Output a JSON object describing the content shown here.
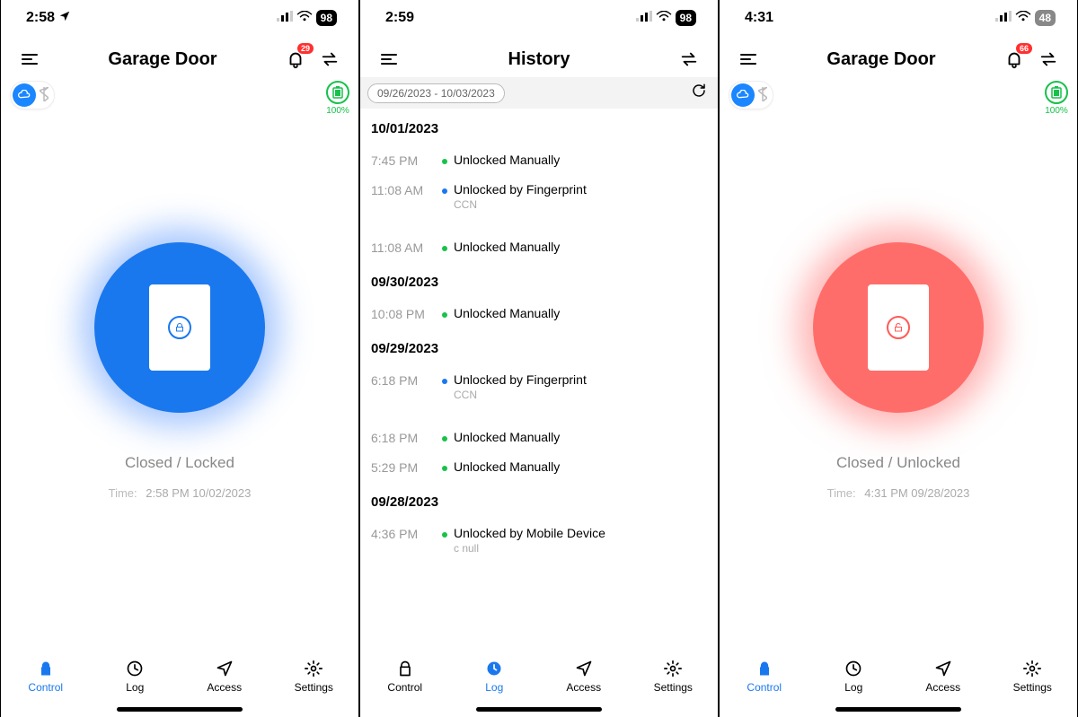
{
  "screens": {
    "control_locked": {
      "statusbar": {
        "time": "2:58",
        "location_arrow": true,
        "battery": "98"
      },
      "header": {
        "title": "Garage Door",
        "bell_badge": "29"
      },
      "battery_pct": "100%",
      "status_text": "Closed / Locked",
      "time_label": "Time:",
      "time_value": "2:58 PM 10/02/2023",
      "circle_color": "blue",
      "lock_state": "locked",
      "tabs": {
        "control": "Control",
        "log": "Log",
        "access": "Access",
        "settings": "Settings"
      },
      "active_tab": "control"
    },
    "history": {
      "statusbar": {
        "time": "2:59",
        "location_arrow": false,
        "battery": "98"
      },
      "header": {
        "title": "History"
      },
      "filter_range": "09/26/2023 - 10/03/2023",
      "days": [
        {
          "date": "10/01/2023",
          "entries": [
            {
              "time": "7:45 PM",
              "dot": "green",
              "text": "Unlocked Manually"
            },
            {
              "time": "11:08 AM",
              "dot": "blue",
              "text": "Unlocked by Fingerprint",
              "sub": "CCN"
            },
            {
              "time": "11:08 AM",
              "dot": "green",
              "text": "Unlocked Manually"
            }
          ]
        },
        {
          "date": "09/30/2023",
          "entries": [
            {
              "time": "10:08 PM",
              "dot": "green",
              "text": "Unlocked Manually"
            }
          ]
        },
        {
          "date": "09/29/2023",
          "entries": [
            {
              "time": "6:18 PM",
              "dot": "blue",
              "text": "Unlocked by Fingerprint",
              "sub": "CCN"
            },
            {
              "time": "6:18 PM",
              "dot": "green",
              "text": "Unlocked Manually"
            },
            {
              "time": "5:29 PM",
              "dot": "green",
              "text": "Unlocked Manually"
            }
          ]
        },
        {
          "date": "09/28/2023",
          "entries": [
            {
              "time": "4:36 PM",
              "dot": "green",
              "text": "Unlocked by Mobile Device",
              "sub": "c null"
            }
          ]
        }
      ],
      "tabs": {
        "control": "Control",
        "log": "Log",
        "access": "Access",
        "settings": "Settings"
      },
      "active_tab": "log"
    },
    "control_unlocked": {
      "statusbar": {
        "time": "4:31",
        "location_arrow": false,
        "battery": "48"
      },
      "header": {
        "title": "Garage Door",
        "bell_badge": "66"
      },
      "battery_pct": "100%",
      "status_text": "Closed / Unlocked",
      "time_label": "Time:",
      "time_value": "4:31 PM 09/28/2023",
      "circle_color": "red",
      "lock_state": "unlocked",
      "tabs": {
        "control": "Control",
        "log": "Log",
        "access": "Access",
        "settings": "Settings"
      },
      "active_tab": "control"
    }
  }
}
